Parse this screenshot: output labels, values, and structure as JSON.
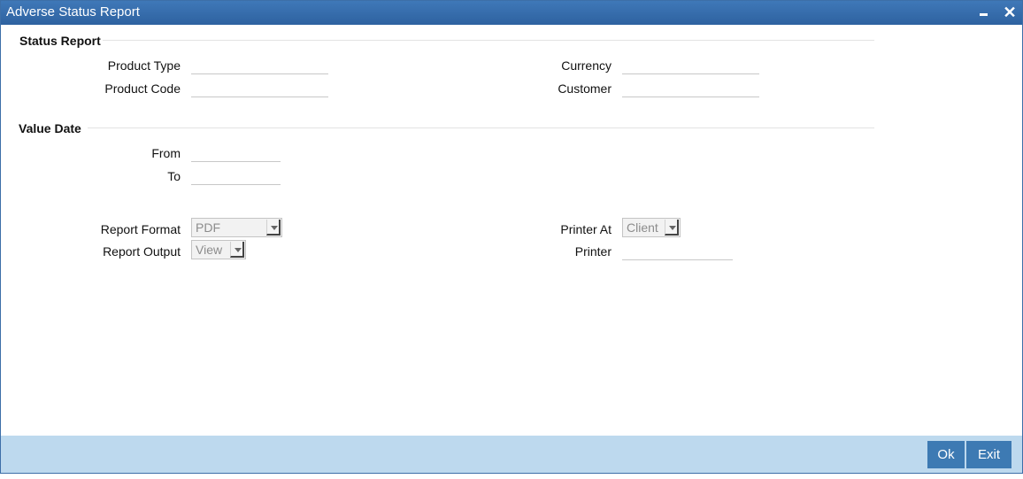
{
  "window": {
    "title": "Adverse Status Report"
  },
  "status_report": {
    "heading": "Status Report",
    "product_type_label": "Product Type",
    "product_type_value": "",
    "product_code_label": "Product Code",
    "product_code_value": "",
    "currency_label": "Currency",
    "currency_value": "",
    "customer_label": "Customer",
    "customer_value": ""
  },
  "value_date": {
    "heading": "Value Date",
    "from_label": "From",
    "from_value": "",
    "to_label": "To",
    "to_value": ""
  },
  "report": {
    "format_label": "Report Format",
    "format_value": "PDF",
    "output_label": "Report Output",
    "output_value": "View",
    "printer_at_label": "Printer At",
    "printer_at_value": "Client",
    "printer_label": "Printer",
    "printer_value": ""
  },
  "footer": {
    "ok_label": "Ok",
    "exit_label": "Exit"
  },
  "colors": {
    "titlebar": "#2e62a0",
    "footer": "#bdd9ee",
    "button": "#3d7ab3"
  }
}
